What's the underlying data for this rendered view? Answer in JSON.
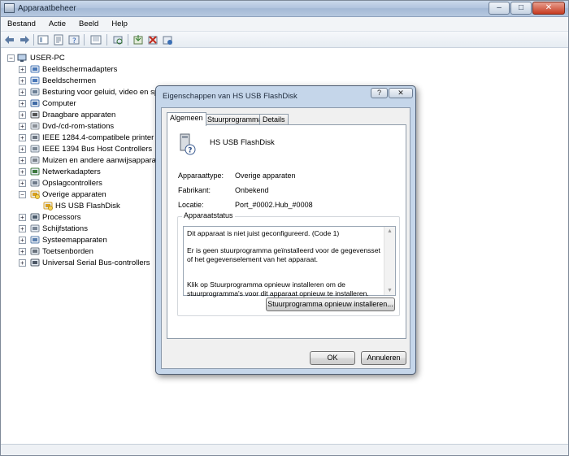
{
  "window": {
    "title": "Apparaatbeheer"
  },
  "menu": [
    "Bestand",
    "Actie",
    "Beeld",
    "Help"
  ],
  "tree": {
    "root": "USER-PC",
    "items": [
      {
        "label": "Beeldschermadapters",
        "icon": "monitor-icon"
      },
      {
        "label": "Beeldschermen",
        "icon": "monitor-icon"
      },
      {
        "label": "Besturing voor geluid, video en spe",
        "icon": "speaker-icon"
      },
      {
        "label": "Computer",
        "icon": "computer-icon"
      },
      {
        "label": "Draagbare apparaten",
        "icon": "portable-device-icon"
      },
      {
        "label": "Dvd-/cd-rom-stations",
        "icon": "cdrom-icon"
      },
      {
        "label": "IEEE 1284.4-compatibele printer",
        "icon": "printer-icon"
      },
      {
        "label": "IEEE 1394 Bus Host Controllers",
        "icon": "firewire-icon"
      },
      {
        "label": "Muizen en andere aanwijsapparate",
        "icon": "mouse-icon"
      },
      {
        "label": "Netwerkadapters",
        "icon": "network-icon"
      },
      {
        "label": "Opslagcontrollers",
        "icon": "storage-icon"
      },
      {
        "label": "Overige apparaten",
        "icon": "unknown-device-icon"
      },
      {
        "label": "HS USB FlashDisk",
        "icon": "warning-device-icon"
      },
      {
        "label": "Processors",
        "icon": "processor-icon"
      },
      {
        "label": "Schijfstations",
        "icon": "disk-icon"
      },
      {
        "label": "Systeemapparaten",
        "icon": "system-icon"
      },
      {
        "label": "Toetsenborden",
        "icon": "keyboard-icon"
      },
      {
        "label": "Universal Serial Bus-controllers",
        "icon": "usb-icon"
      }
    ]
  },
  "dialog": {
    "title": "Eigenschappen van HS USB FlashDisk",
    "help_glyph": "?",
    "close_glyph": "✕",
    "tabs": [
      "Algemeen",
      "Stuurprogramma",
      "Details"
    ],
    "device_name": "HS USB FlashDisk",
    "properties": [
      {
        "label": "Apparaattype:",
        "value": "Overige apparaten"
      },
      {
        "label": "Fabrikant:",
        "value": "Onbekend"
      },
      {
        "label": "Locatie:",
        "value": "Port_#0002.Hub_#0008"
      }
    ],
    "status_group_title": "Apparaatstatus",
    "status_text": "Dit apparaat is niet juist geconfigureerd. (Code 1)\n\nEr is geen stuurprogramma geïnstalleerd voor de gegevensset of het gegevenselement van het apparaat.\n\n\nKlik op Stuurprogramma opnieuw installeren om de stuurprogramma's voor dit apparaat opnieuw te installeren.",
    "reinstall_button": "Stuurprogramma opnieuw installeren...",
    "ok_button": "OK",
    "cancel_button": "Annuleren"
  }
}
